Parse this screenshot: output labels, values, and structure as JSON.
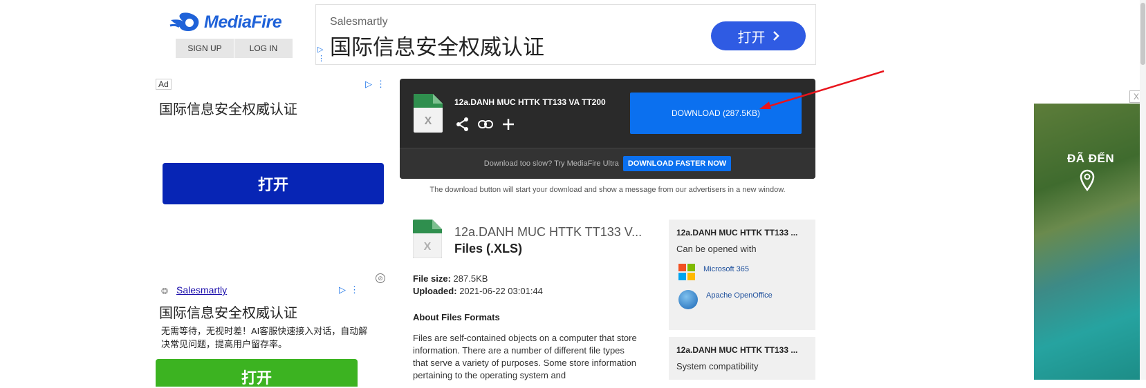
{
  "logo": {
    "text": "MediaFire"
  },
  "auth": {
    "signup": "SIGN UP",
    "login": "LOG IN"
  },
  "top_ad": {
    "brand": "Salesmartly",
    "headline": "国际信息安全权威认证",
    "button": "打开",
    "button_icon": "chevron-right-icon",
    "adchoices_icon": "adchoices-icon"
  },
  "left_ad": {
    "tag": "Ad",
    "headline1": "国际信息安全权威认证",
    "button1": "打开",
    "brand": "Salesmartly",
    "headline2": "国际信息安全权威认证",
    "body": "无需等待，无视时差！AI客服快速接入对话，自动解决常见问题，提高用户留存率。",
    "button2": "打开"
  },
  "download": {
    "file_name": "12a.DANH MUC HTTK TT133 VA TT200",
    "button": "DOWNLOAD (287.5KB)",
    "slow_text": "Download too slow? Try MediaFire Ultra",
    "faster_button": "DOWNLOAD FASTER NOW",
    "note": "The download button will start your download and show a message from our advertisers in a new window.",
    "actions": [
      "share-icon",
      "link-icon",
      "add-icon"
    ],
    "accent": "#0b70ef",
    "annotation_arrow_color": "#e8141c"
  },
  "details": {
    "name": "12a.DANH MUC HTTK TT133 V...",
    "type": "Files (.XLS)",
    "size_label": "File size:",
    "size_value": "287.5KB",
    "uploaded_label": "Uploaded:",
    "uploaded_value": "2021-06-22 03:01:44",
    "about_title": "About Files Formats",
    "about_text": "Files are self-contained objects on a computer that store information. There are a number of different file types that serve a variety of purposes. Some store information pertaining to the operating system and"
  },
  "panel1": {
    "title": "12a.DANH MUC HTTK TT133 ...",
    "subtitle": "Can be opened with",
    "apps": [
      {
        "name": "Microsoft 365",
        "icon": "microsoft-365-icon"
      },
      {
        "name": "Apache OpenOffice",
        "icon": "openoffice-icon"
      }
    ]
  },
  "panel2": {
    "title": "12a.DANH MUC HTTK TT133 ...",
    "subtitle": "System compatibility"
  },
  "right_ad": {
    "text": "ĐÃ ĐẾN",
    "close": "X",
    "pin_icon": "location-pin-icon"
  }
}
